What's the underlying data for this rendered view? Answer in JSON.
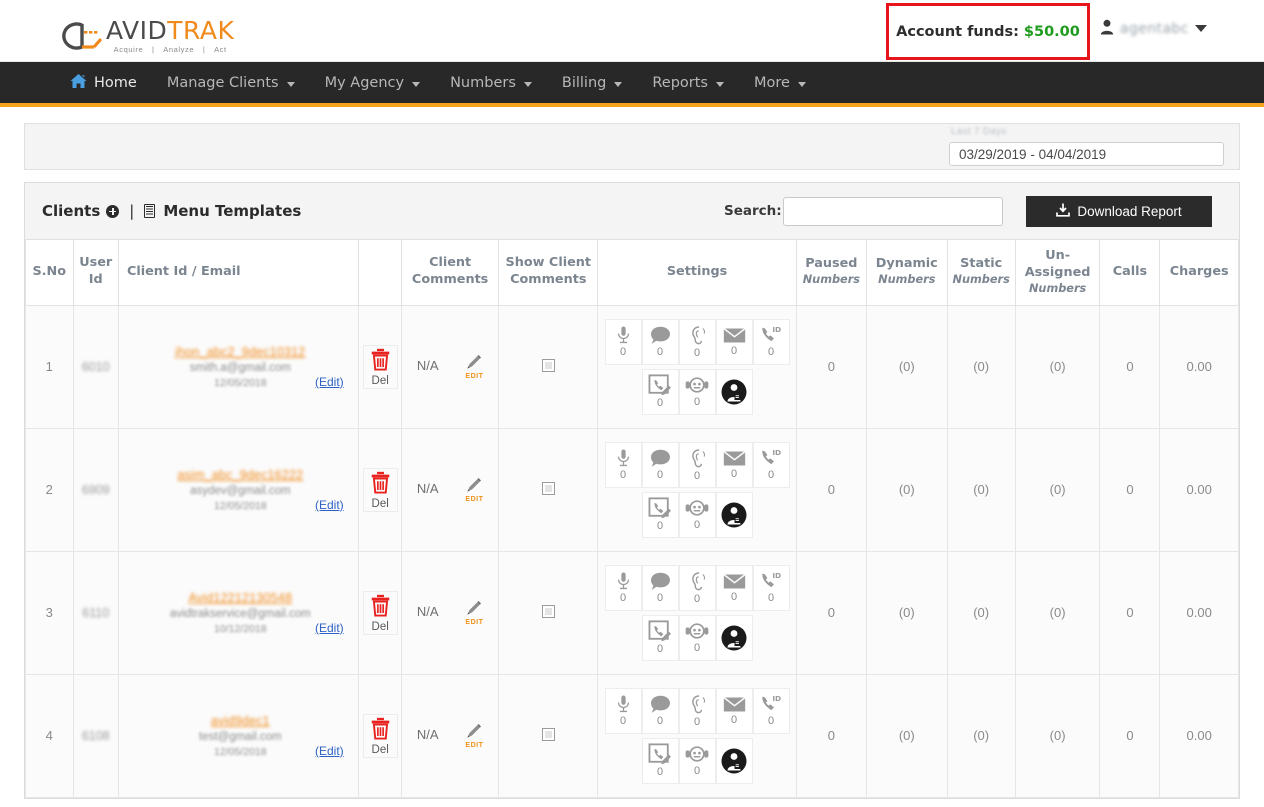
{
  "brand": {
    "name_part1": "AVID",
    "name_part2": "TRAK",
    "tagline_1": "Acquire",
    "tagline_sep": "|",
    "tagline_2": "Analyze",
    "tagline_3": "Act",
    "accent_orange": "#f08a1c",
    "dark": "#4b4b4b"
  },
  "header": {
    "funds_label": "Account funds:",
    "funds_amount": "$50.00",
    "funds_box_border_color": "#e8141c",
    "funds_amount_color": "#1f9b1f",
    "user_name": "agentabc",
    "user_icon": "user-icon",
    "caret_icon": "chevron-down-icon"
  },
  "nav": {
    "items": [
      {
        "label": "Home",
        "icon": "home-icon",
        "has_caret": false,
        "active": true
      },
      {
        "label": "Manage Clients",
        "icon": "",
        "has_caret": true,
        "active": false
      },
      {
        "label": "My Agency",
        "icon": "",
        "has_caret": true,
        "active": false
      },
      {
        "label": "Numbers",
        "icon": "",
        "has_caret": true,
        "active": false
      },
      {
        "label": "Billing",
        "icon": "",
        "has_caret": true,
        "active": false
      },
      {
        "label": "Reports",
        "icon": "",
        "has_caret": true,
        "active": false
      },
      {
        "label": "More",
        "icon": "",
        "has_caret": true,
        "active": false
      }
    ]
  },
  "date_panel": {
    "floating_label": "Last 7 Days",
    "range_value": "03/29/2019 - 04/04/2019"
  },
  "card": {
    "title_clients": "Clients",
    "separator": "|",
    "title_templates": "Menu Templates",
    "add_icon": "plus-circle-icon",
    "template_icon": "template-icon",
    "search_label": "Search:",
    "search_value": "",
    "search_placeholder": "",
    "download_label": "Download Report",
    "download_icon": "download-icon"
  },
  "table": {
    "columns": [
      {
        "label": "S.No",
        "sub": ""
      },
      {
        "label": "User Id",
        "sub": ""
      },
      {
        "label": "Client Id / Email",
        "sub": ""
      },
      {
        "label": "",
        "sub": ""
      },
      {
        "label": "Client Comments",
        "sub": ""
      },
      {
        "label": "Show Client Comments",
        "sub": ""
      },
      {
        "label": "Settings",
        "sub": ""
      },
      {
        "label": "Paused",
        "sub": "Numbers"
      },
      {
        "label": "Dynamic",
        "sub": "Numbers"
      },
      {
        "label": "Static",
        "sub": "Numbers"
      },
      {
        "label": "Un-Assigned",
        "sub": "Numbers"
      },
      {
        "label": "Calls",
        "sub": ""
      },
      {
        "label": "Charges",
        "sub": ""
      }
    ],
    "del_label": "Del",
    "edit_label": "EDIT",
    "edit_link_label": "(Edit)",
    "na_label": "N/A",
    "settings_icons_row1": [
      {
        "icon": "microphone-icon",
        "count": "0"
      },
      {
        "icon": "speech-bubble-icon",
        "count": "0"
      },
      {
        "icon": "ear-whisper-icon",
        "count": "0"
      },
      {
        "icon": "envelope-icon",
        "count": "0"
      },
      {
        "icon": "caller-id-phone-icon",
        "count": "0"
      }
    ],
    "settings_icons_row2": [
      {
        "icon": "call-note-icon",
        "count": "0"
      },
      {
        "icon": "headset-agent-icon",
        "count": "0"
      },
      {
        "icon": "person-badge-icon",
        "count": ""
      }
    ],
    "rows": [
      {
        "sno": "1",
        "user_id": "6010",
        "client_name": "jhon_abc2_9dec10312",
        "client_email": "smith.a@gmail.com",
        "client_date": "12/05/2018",
        "comments": "N/A",
        "show_comments_checked": false,
        "paused": "0",
        "dynamic": "(0)",
        "static": "(0)",
        "unassigned": "(0)",
        "calls": "0",
        "charges": "0.00"
      },
      {
        "sno": "2",
        "user_id": "6909",
        "client_name": "asim_abc_9dec16222",
        "client_email": "asydev@gmail.com",
        "client_date": "12/05/2018",
        "comments": "N/A",
        "show_comments_checked": false,
        "paused": "0",
        "dynamic": "(0)",
        "static": "(0)",
        "unassigned": "(0)",
        "calls": "0",
        "charges": "0.00"
      },
      {
        "sno": "3",
        "user_id": "6110",
        "client_name": "Avid12212130548",
        "client_email": "avidtrakservice@gmail.com",
        "client_date": "10/12/2018",
        "comments": "N/A",
        "show_comments_checked": false,
        "paused": "0",
        "dynamic": "(0)",
        "static": "(0)",
        "unassigned": "(0)",
        "calls": "0",
        "charges": "0.00"
      },
      {
        "sno": "4",
        "user_id": "6108",
        "client_name": "avid9dec1",
        "client_email": "test@gmail.com",
        "client_date": "12/05/2018",
        "comments": "N/A",
        "show_comments_checked": false,
        "paused": "0",
        "dynamic": "(0)",
        "static": "(0)",
        "unassigned": "(0)",
        "calls": "0",
        "charges": "0.00"
      }
    ]
  }
}
